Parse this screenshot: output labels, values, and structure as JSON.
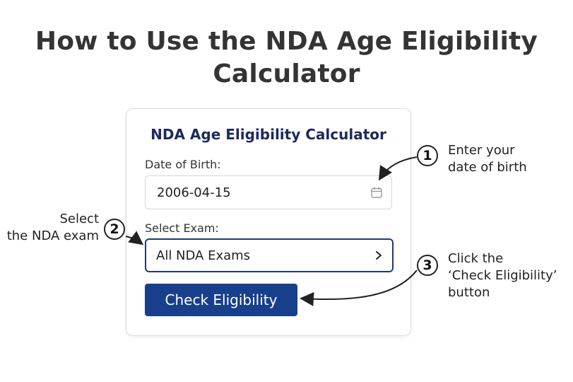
{
  "title": {
    "line1": "How to Use the NDA Age Eligibility",
    "line2": "Calculator"
  },
  "calculator": {
    "title": "NDA Age Eligibility Calculator",
    "dob_label": "Date of Birth:",
    "dob_value": "2006-04-15",
    "exam_label": "Select Exam:",
    "exam_selected": "All NDA Exams",
    "check_button": "Check Eligibility"
  },
  "steps": [
    {
      "number": "1",
      "lines": [
        "Enter your",
        "date of birth"
      ]
    },
    {
      "number": "2",
      "lines": [
        "Select",
        "the NDA exam"
      ]
    },
    {
      "number": "3",
      "lines": [
        "Click the",
        "‘Check Eligibility’",
        "button"
      ]
    }
  ],
  "icons": {
    "date_field": "calendar-icon",
    "select_field": "chevron-right-icon"
  },
  "colors": {
    "button_bg": "#183f8c",
    "card_title": "#1c2a5c",
    "select_border": "#1f3b6f"
  }
}
